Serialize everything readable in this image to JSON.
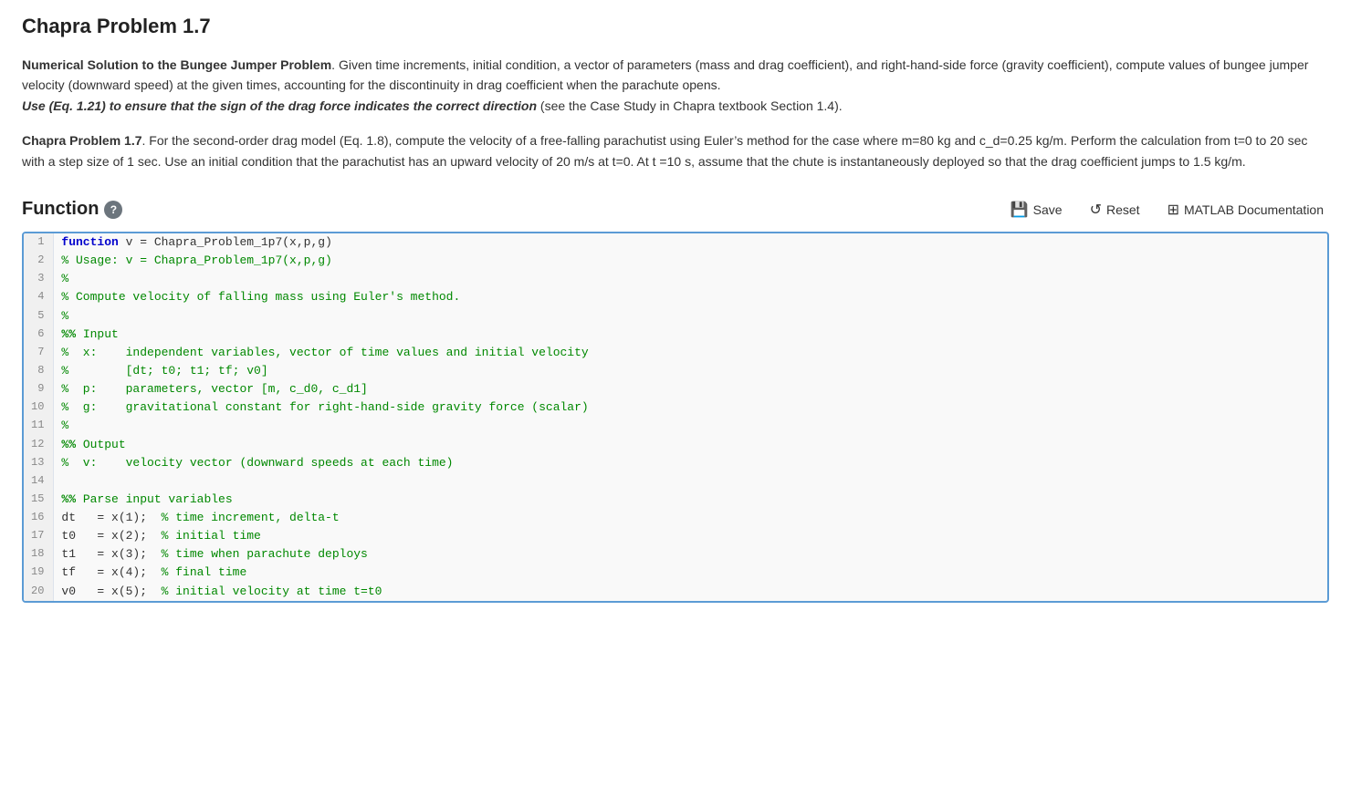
{
  "page": {
    "title": "Chapra Problem 1.7",
    "description1_bold": "Numerical Solution to the Bungee Jumper Problem",
    "description1_text": ". Given time increments, initial condition, a vector of parameters (mass and drag coefficient), and right-hand-side force (gravity coefficient), compute values of bungee jumper velocity (downward speed) at the given times, accounting for the discontinuity in drag coefficient when the parachute opens.",
    "description1_italic": "Use (Eq. 1.21) to ensure that the sign of the drag force indicates the correct direction",
    "description1_italic_end": " (see the Case Study in Chapra textbook Section 1.4).",
    "description2_bold": "Chapra Problem 1.7",
    "description2_text": ". For the second-order drag model (Eq. 1.8), compute the velocity of a free-falling parachutist using Euler’s method for the case where m=80 kg and c_d=0.25 kg/m. Perform the calculation from t=0 to 20 sec with a step size of 1 sec. Use an initial condition that the parachutist has an upward velocity of 20 m/s at t=0. At t =10 s, assume that the chute is instantaneously deployed so that the drag coefficient jumps to 1.5 kg/m.",
    "section_title": "Function",
    "help_icon_label": "?",
    "toolbar": {
      "save_label": "Save",
      "reset_label": "Reset",
      "matlab_doc_label": "MATLAB Documentation"
    },
    "code_lines": [
      {
        "num": 1,
        "code": "function v = Chapra_Problem_1p7(x,p,g)",
        "keyword": "function",
        "rest": " v = Chapra_Problem_1p7(x,p,g)"
      },
      {
        "num": 2,
        "code": "% Usage: v = Chapra_Problem_1p7(x,p,g)",
        "type": "comment"
      },
      {
        "num": 3,
        "code": "%",
        "type": "comment"
      },
      {
        "num": 4,
        "code": "% Compute velocity of falling mass using Euler's method.",
        "type": "comment"
      },
      {
        "num": 5,
        "code": "%",
        "type": "comment"
      },
      {
        "num": 6,
        "code": "%% Input",
        "type": "comment2"
      },
      {
        "num": 7,
        "code": "%  x:    independent variables, vector of time values and initial velocity",
        "type": "comment"
      },
      {
        "num": 8,
        "code": "%        [dt; t0; t1; tf; v0]",
        "type": "comment"
      },
      {
        "num": 9,
        "code": "%  p:    parameters, vector [m, c_d0, c_d1]",
        "type": "comment"
      },
      {
        "num": 10,
        "code": "%  g:    gravitational constant for right-hand-side gravity force (scalar)",
        "type": "comment"
      },
      {
        "num": 11,
        "code": "%",
        "type": "comment"
      },
      {
        "num": 12,
        "code": "%% Output",
        "type": "comment2"
      },
      {
        "num": 13,
        "code": "%  v:    velocity vector (downward speeds at each time)",
        "type": "comment"
      },
      {
        "num": 14,
        "code": "",
        "type": "blank"
      },
      {
        "num": 15,
        "code": "%% Parse input variables",
        "type": "comment2"
      },
      {
        "num": 16,
        "code": "dt   = x(1);  % time increment, delta-t",
        "type": "mixed"
      },
      {
        "num": 17,
        "code": "t0   = x(2);  % initial time",
        "type": "mixed"
      },
      {
        "num": 18,
        "code": "t1   = x(3);  % time when parachute deploys",
        "type": "mixed"
      },
      {
        "num": 19,
        "code": "tf   = x(4);  % final time",
        "type": "mixed"
      },
      {
        "num": 20,
        "code": "v0   = x(5);  % initial velocity at time t=t0",
        "type": "mixed"
      }
    ]
  }
}
